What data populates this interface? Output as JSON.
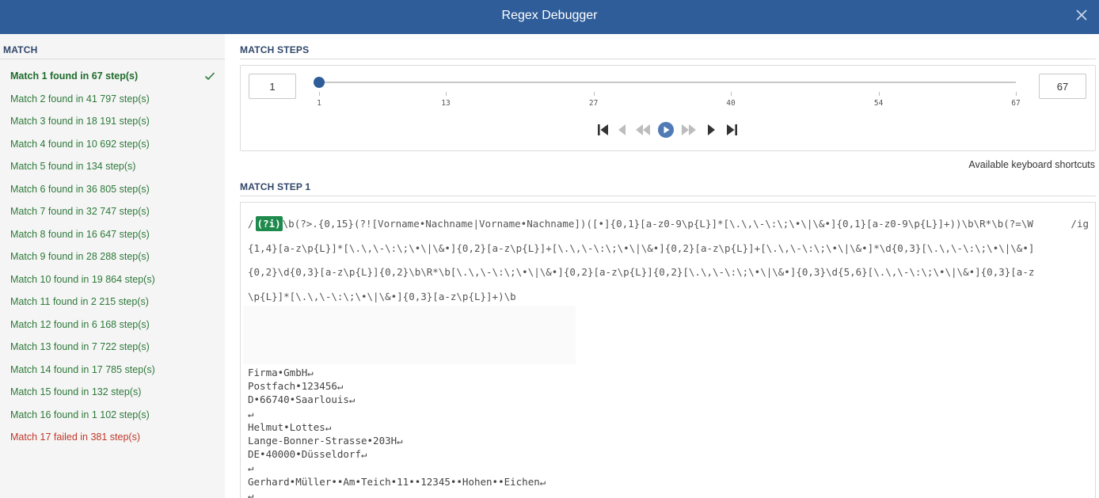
{
  "window": {
    "title": "Regex Debugger"
  },
  "sidebar": {
    "heading": "MATCH",
    "matches": [
      {
        "label": "Match 1 found in 67 step(s)",
        "status": "active"
      },
      {
        "label": "Match 2 found in 41 797 step(s)",
        "status": "found"
      },
      {
        "label": "Match 3 found in 18 191 step(s)",
        "status": "found"
      },
      {
        "label": "Match 4 found in 10 692 step(s)",
        "status": "found"
      },
      {
        "label": "Match 5 found in 134 step(s)",
        "status": "found"
      },
      {
        "label": "Match 6 found in 36 805 step(s)",
        "status": "found"
      },
      {
        "label": "Match 7 found in 32 747 step(s)",
        "status": "found"
      },
      {
        "label": "Match 8 found in 16 647 step(s)",
        "status": "found"
      },
      {
        "label": "Match 9 found in 28 288 step(s)",
        "status": "found"
      },
      {
        "label": "Match 10 found in 19 864 step(s)",
        "status": "found"
      },
      {
        "label": "Match 11 found in 2 215 step(s)",
        "status": "found"
      },
      {
        "label": "Match 12 found in 6 168 step(s)",
        "status": "found"
      },
      {
        "label": "Match 13 found in 7 722 step(s)",
        "status": "found"
      },
      {
        "label": "Match 14 found in 17 785 step(s)",
        "status": "found"
      },
      {
        "label": "Match 15 found in 132 step(s)",
        "status": "found"
      },
      {
        "label": "Match 16 found in 1 102 step(s)",
        "status": "found"
      },
      {
        "label": "Match 17 failed in 381 step(s)",
        "status": "failed"
      }
    ]
  },
  "steps": {
    "heading": "MATCH STEPS",
    "current_step": "1",
    "total_steps": "67",
    "slider": {
      "min": 1,
      "max": 67,
      "value": 1,
      "ticks": [
        "1",
        "13",
        "27",
        "40",
        "54",
        "67"
      ]
    },
    "controls": [
      "first-step",
      "previous-step",
      "rewind",
      "play",
      "fast-forward",
      "next-step",
      "last-step"
    ]
  },
  "shortcuts_link": "Available keyboard shortcuts",
  "step_view": {
    "heading": "MATCH STEP 1",
    "regex_open": "/",
    "regex_highlight": "(?i)",
    "regex_rest": "\\b(?>.{0,15}(?![Vorname•Nachname|Vorname•Nachname])([•]{0,1}[a-z0-9\\p{L}]*[\\.\\,\\-\\:\\;\\•\\|\\&•]{0,1}[a-z0-9\\p{L}]+))\\b\\R*\\b(?=\\W{1,4}[a-z\\p{L}]*[\\.\\,\\-\\:\\;\\•\\|\\&•]{0,2}[a-z\\p{L}]+[\\.\\,\\-\\:\\;\\•\\|\\&•]{0,2}[a-z\\p{L}]+[\\.\\,\\-\\:\\;\\•\\|\\&•]*\\d{0,3}[\\.\\,\\-\\:\\;\\•\\|\\&•]{0,2}\\d{0,3}[a-z\\p{L}]{0,2}\\b\\R*\\b[\\.\\,\\-\\:\\;\\•\\|\\&•]{0,2}[a-z\\p{L}]{0,2}[\\.\\,\\-\\:\\;\\•\\|\\&•]{0,3}\\d{5,6}[\\.\\,\\-\\:\\;\\•\\|\\&•]{0,3}[a-z\\p{L}]*[\\.\\,\\-\\:\\;\\•\\|\\&•]{0,3}[a-z\\p{L}]+)\\b",
    "regex_flags": "/ig",
    "subject_text": "Firma•GmbH↵\nPostfach•123456↵\nD•66740•Saarlouis↵\n↵\nHelmut•Lottes↵\nLange-Bonner-Strasse•203H↵\nDE•40000•Düsseldorf↵\n↵\nGerhard•Müller••Am•Teich•11••12345••Hohen••Eichen↵\n↵"
  },
  "colors": {
    "titlebar": "#2e5d99",
    "match_found": "#2d7a3a",
    "match_failed": "#c0392b",
    "highlight": "#1f8a4d"
  }
}
